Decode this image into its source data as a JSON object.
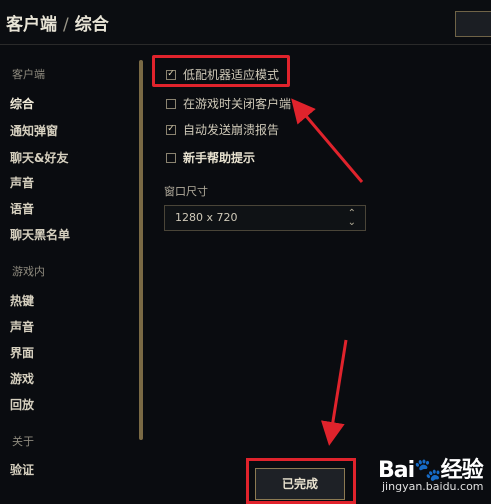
{
  "header": {
    "section": "客户端",
    "separator": "/",
    "title": "综合"
  },
  "sidebar": {
    "section_client": "客户端",
    "client_items": [
      "综合",
      "通知弹窗",
      "聊天&好友",
      "声音",
      "语音",
      "聊天黑名单"
    ],
    "section_ingame": "游戏内",
    "ingame_items": [
      "热键",
      "声音",
      "界面",
      "游戏",
      "回放"
    ],
    "section_about": "关于",
    "about_items": [
      "验证"
    ]
  },
  "options": [
    {
      "label": "低配机器适应模式",
      "checked": true
    },
    {
      "label": "在游戏时关闭客户端",
      "checked": false
    },
    {
      "label": "自动发送崩溃报告",
      "checked": true
    },
    {
      "label": "新手帮助提示",
      "checked": false
    }
  ],
  "window_size": {
    "label": "窗口尺寸",
    "value": "1280 x 720"
  },
  "done_label": "已完成",
  "watermark": {
    "brand": "Bai",
    "brand2": "经验",
    "url": "jingyan.baidu.com"
  },
  "colors": {
    "accent_gold": "#8c7a52",
    "annotation_red": "#e0232c"
  }
}
